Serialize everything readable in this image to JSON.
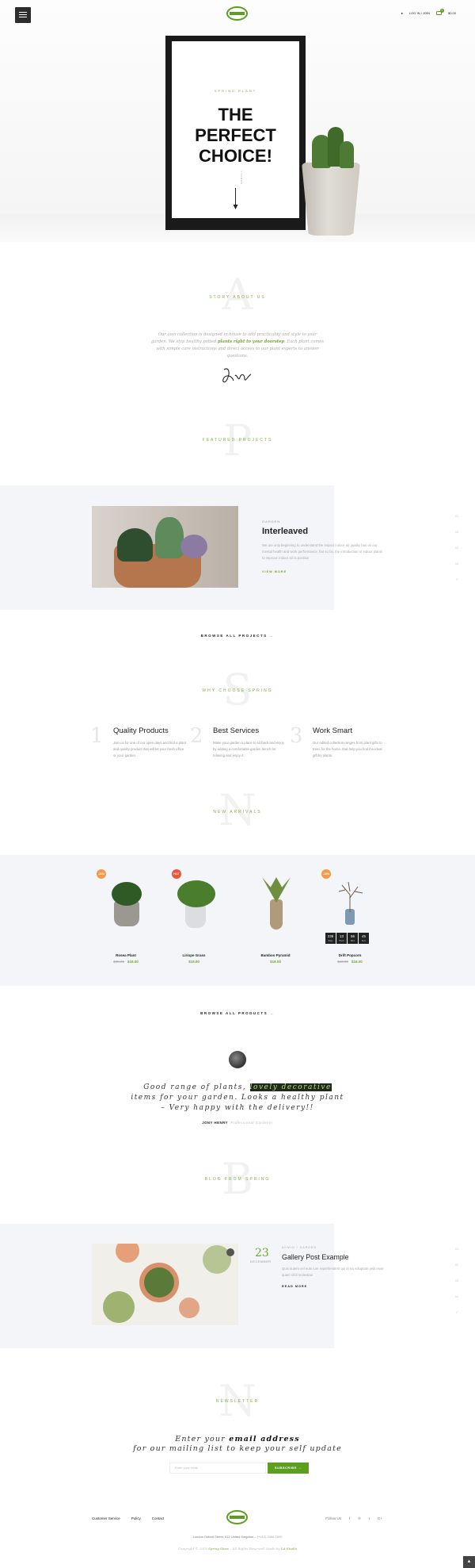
{
  "header": {
    "login_label": "LOG IN / JOIN",
    "cart_count": "0",
    "cart_total": "$0.00"
  },
  "hero": {
    "eyebrow": "SPRING PLANT",
    "title_line1": "THE",
    "title_line2": "PERFECT",
    "title_line3": "CHOICE!",
    "scroll_label": "SCROLL"
  },
  "story": {
    "letter": "A",
    "title": "STORY ABOUT US",
    "text_before": "Our own collection is designed in house to add practicality and style to your garden. We ship healthy potted ",
    "text_highlight": "plants right to your doorstep",
    "text_after": ". Each plant comes with simple care instructions and direct access to our plant experts to answer questions."
  },
  "projects": {
    "letter": "P",
    "title": "FEATURED PROJECTS",
    "category": "GARDEN",
    "name": "Interleaved",
    "description": "We are only beginning to understand the impact indoor air quality has on our mental health and work performance, but so far, the introduction of indoor plants to improve indoor air is positive",
    "link": "VIEW MORE",
    "pager": [
      "01",
      "02",
      "03",
      "04"
    ],
    "browse": "BROWSE ALL PROJECTS"
  },
  "why": {
    "letter": "S",
    "title": "WHY CHOOSE SPRING",
    "items": [
      {
        "num": "1",
        "title": "Quality Products",
        "text": "Join us for one of our open days and find a plant and quality product that will let your fresh office or your garden."
      },
      {
        "num": "2",
        "title": "Best Services",
        "text": "Make your garden a place to sit back and enjoy by adding a comfortable garden bench for relaxing and enjoy it."
      },
      {
        "num": "3",
        "title": "Work Smart",
        "text": "Our edited collection ranges from plant gifts to trees for the home, that help you find the ideal gift by plants."
      }
    ]
  },
  "arrivals": {
    "letter": "N",
    "title": "NEW ARRIVALS",
    "products": [
      {
        "badge": "-20%",
        "name": "Rosea Plant",
        "old_price": "$45.00",
        "price": "$18.00"
      },
      {
        "badge": "HOT",
        "name": "Liriope Grass",
        "old_price": "",
        "price": "$19.00"
      },
      {
        "badge": "",
        "name": "Bamboo Pyramid",
        "old_price": "",
        "price": "$18.00"
      },
      {
        "badge": "-10%",
        "name": "Drift Popcorn",
        "old_price": "$18.00",
        "price": "$16.00"
      }
    ],
    "countdown": [
      {
        "value": "239",
        "unit": "Days"
      },
      {
        "value": "13",
        "unit": "Hours"
      },
      {
        "value": "56",
        "unit": "Mins"
      },
      {
        "value": "45",
        "unit": "Secs"
      }
    ],
    "browse": "BROWSE ALL PRODUCTS"
  },
  "testimonial": {
    "line1_before": "Good range of plants, ",
    "line1_highlight": "lovely decorative",
    "line2": "items for your garden. Looks a healthy plant",
    "line3": "– Very happy with the delivery!!",
    "author": "JONY HENRY",
    "role": "Professional Gardener"
  },
  "blog": {
    "letter": "B",
    "title": "BLOG FROM SPRING",
    "day": "23",
    "month": "DECEMBER",
    "meta": "ADMIN / GARDEN",
    "post_title": "Gallery Post Example",
    "excerpt": "Quis autem vel eum iure reprehenderit qui in ea voluptate velit esse quam nihil molestiae",
    "read_more": "READ MORE",
    "pager": [
      "01",
      "02",
      "03",
      "04"
    ]
  },
  "newsletter": {
    "letter": "N",
    "title": "NEWSLETTER",
    "line1_before": "Enter your ",
    "line1_bold": "email address",
    "line2": "for our mailing list to keep your self update",
    "placeholder": "Enter your email",
    "button": "SUBSCRIBE"
  },
  "footer": {
    "links": [
      "Customer Service",
      "Policy",
      "Contact"
    ],
    "follow": "Follow Us",
    "address": "London Oxford Street, 012 United Kingdom",
    "phone": "(+012) 3456 7890",
    "copyright_before": "Copyright © 2018 ",
    "brand": "Spring Store",
    "copyright_after": " – All Rights Reserved. Made by ",
    "author": "LA-Studio"
  },
  "colors": {
    "accent": "#5c9e1f",
    "dark": "#1a1a1a",
    "panel": "#f4f5f8"
  }
}
